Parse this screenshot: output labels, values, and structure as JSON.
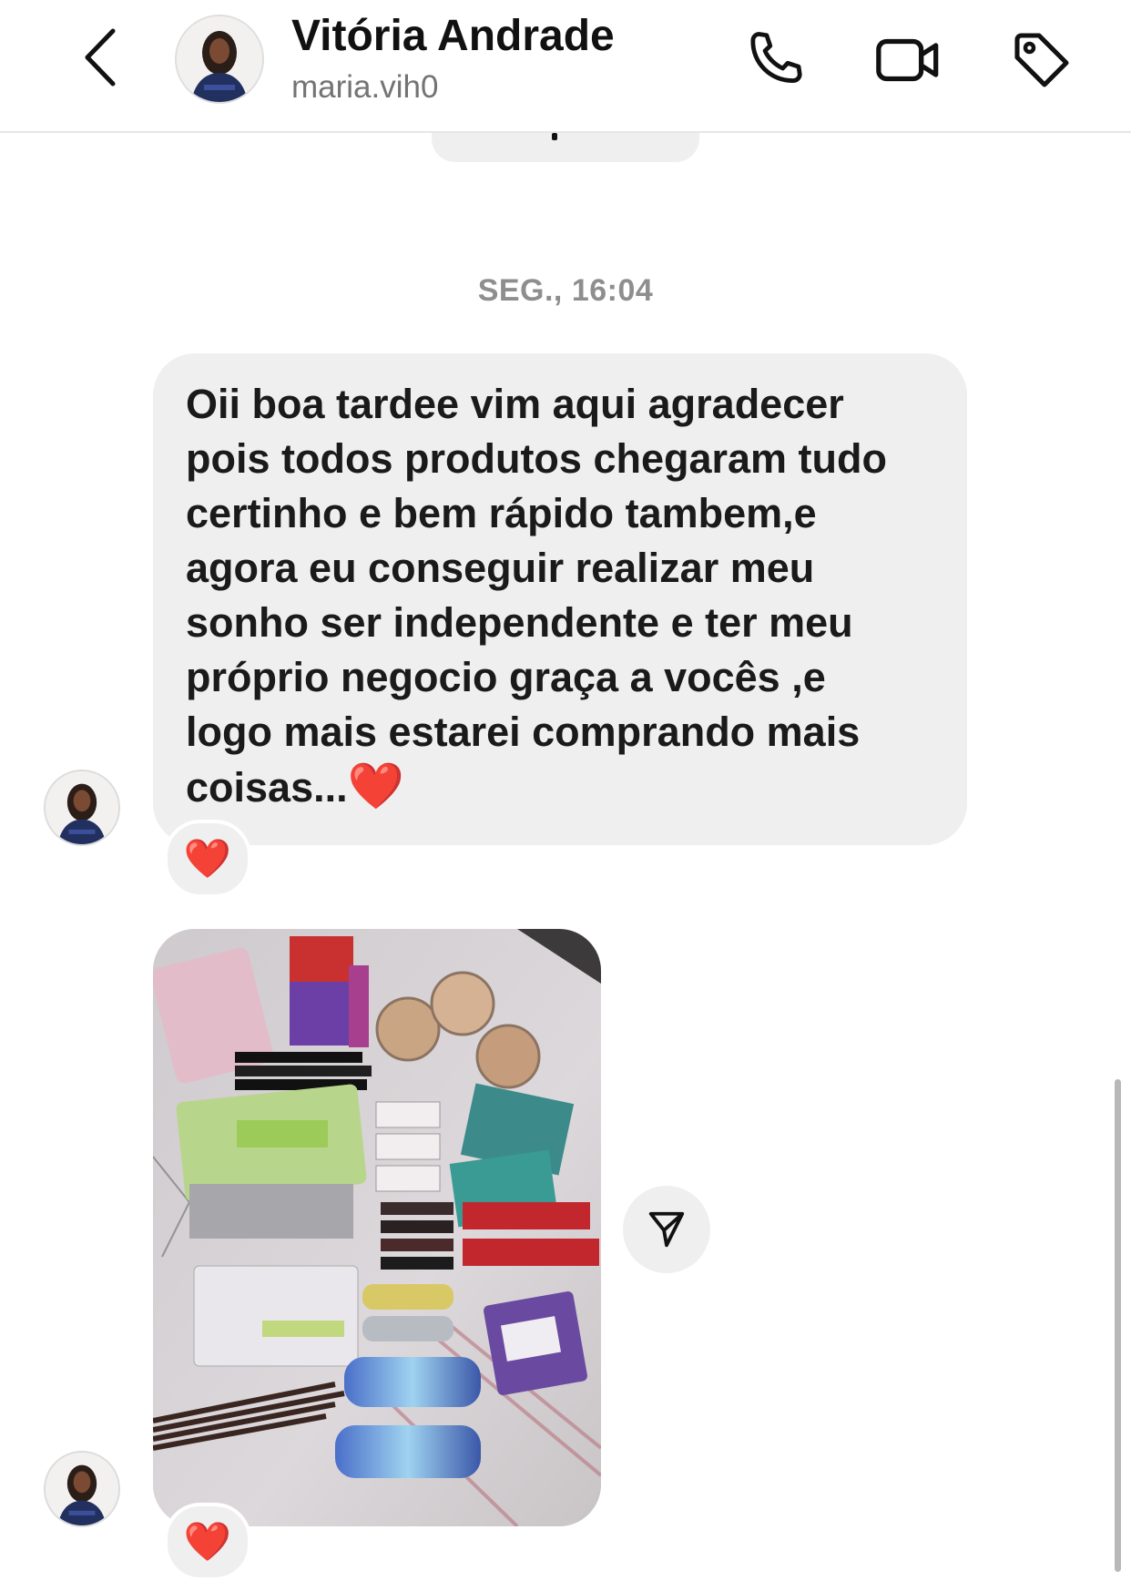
{
  "header": {
    "name": "Vitória Andrade",
    "username": "maria.vih0",
    "icons": {
      "back": "chevron-left-icon",
      "phone": "phone-icon",
      "video": "video-camera-icon",
      "tag": "tag-icon"
    }
  },
  "thread": {
    "timestamp": "SEG., 16:04",
    "messages": [
      {
        "type": "text",
        "text": "Oii boa tardee vim aqui agradecer\npois todos produtos chegaram tudo\ncertinho e bem rápido tambem,e\nagora eu conseguir realizar meu\nsonho ser independente e ter meu\npróprio negocio graça a vocês ,e\nlogo mais estarei comprando mais\ncoisas...",
        "trailing_emoji": "❤️",
        "reaction": "❤️"
      },
      {
        "type": "photo",
        "reaction": "❤️",
        "share_icon": "paper-plane-icon"
      }
    ]
  },
  "colors": {
    "bubble": "#efefef",
    "timestamp": "#8e8e8e",
    "username": "#737373",
    "heart": "#e5322d"
  }
}
